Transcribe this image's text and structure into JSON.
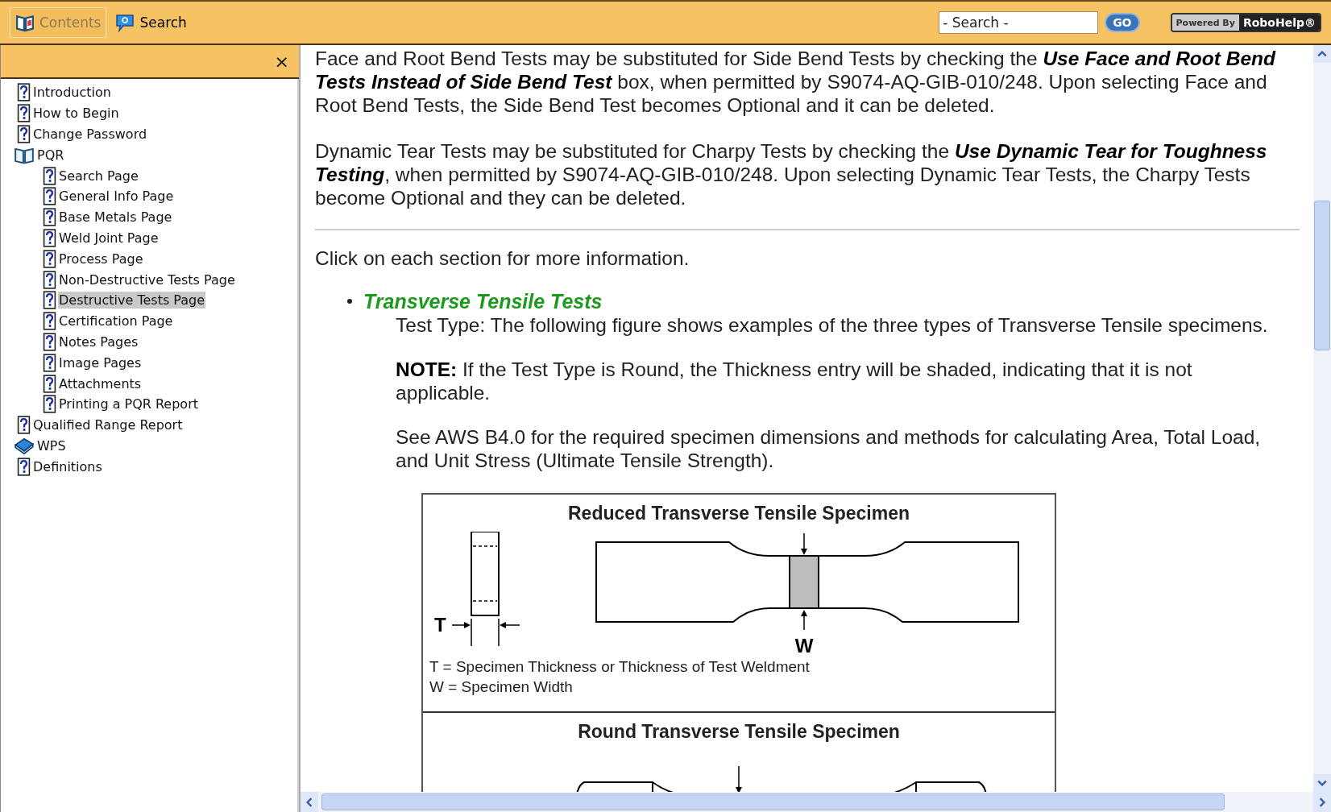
{
  "toolbar": {
    "tabs": [
      {
        "label": "Contents",
        "kind": "contents",
        "selected": true
      },
      {
        "label": "Search",
        "kind": "search",
        "selected": false
      }
    ],
    "search": {
      "placeholder": "- Search -"
    },
    "go_button": "GO",
    "badge": {
      "prefix": "Powered By",
      "brand": "RoboHelp®"
    }
  },
  "sidebar": {
    "close": "×",
    "items": [
      {
        "label": "Introduction",
        "kind": "topic",
        "selected": false
      },
      {
        "label": "How to Begin",
        "kind": "topic",
        "selected": false
      },
      {
        "label": "Change Password",
        "kind": "topic",
        "selected": false
      },
      {
        "label": "PQR",
        "kind": "book",
        "expanded": true,
        "selected": false,
        "children": [
          {
            "label": "Search Page",
            "kind": "topic",
            "selected": false
          },
          {
            "label": "General Info Page",
            "kind": "topic",
            "selected": false
          },
          {
            "label": "Base Metals Page",
            "kind": "topic",
            "selected": false
          },
          {
            "label": "Weld Joint Page",
            "kind": "topic",
            "selected": false
          },
          {
            "label": "Process Page",
            "kind": "topic",
            "selected": false
          },
          {
            "label": "Non-Destructive Tests Page",
            "kind": "topic",
            "selected": false
          },
          {
            "label": "Destructive Tests Page",
            "kind": "topic",
            "selected": true
          },
          {
            "label": "Certification Page",
            "kind": "topic",
            "selected": false
          },
          {
            "label": "Notes Pages",
            "kind": "topic",
            "selected": false
          },
          {
            "label": "Image Pages",
            "kind": "topic",
            "selected": false
          },
          {
            "label": "Attachments",
            "kind": "topic",
            "selected": false
          },
          {
            "label": "Printing a PQR Report",
            "kind": "topic",
            "selected": false
          }
        ]
      },
      {
        "label": "Qualified Range Report",
        "kind": "topic",
        "selected": false
      },
      {
        "label": "WPS",
        "kind": "book",
        "expanded": false,
        "selected": false
      },
      {
        "label": "Definitions",
        "kind": "topic",
        "selected": false
      }
    ]
  },
  "content": {
    "paragraphs": [
      "Face and Root Bend Tests may be substituted for Side Bend Tests by checking the **Use Face and Root Bend Tests Instead of Side Bend Test** box, when permitted by S9074-AQ-GIB-010/248. Upon selecting Face and Root Bend Tests, the Side Bend Test becomes Optional and it can be deleted.",
      "Dynamic Tear Tests may be substituted for Charpy Tests by checking the **Use Dynamic Tear for Toughness Testing**, when permitted by S9074-AQ-GIB-010/248.  Upon selecting Dynamic Tear Tests, the Charpy Tests become Optional and they can be deleted."
    ],
    "intro": "Click on each section for more information.",
    "section": {
      "link": "Transverse Tensile Tests",
      "paragraphs": [
        "Test Type: The following figure shows examples of the three types of Transverse Tensile specimens.",
        "**NOTE:** If the Test Type is Round, the Thickness entry will be shaded, indicating that it is not applicable.",
        "See AWS B4.0 for the required specimen dimensions and methods for calculating Area, Total Load, and Unit Stress (Ultimate Tensile Strength)."
      ],
      "figure": {
        "panels": [
          {
            "title": "Reduced Transverse Tensile Specimen",
            "kind": "reduced",
            "labels": [
              "T",
              "W"
            ],
            "legend": [
              "T = Specimen Thickness or Thickness of Test Weldment",
              "W = Specimen Width"
            ]
          },
          {
            "title": "Round Transverse Tensile Specimen",
            "kind": "round"
          }
        ]
      }
    }
  }
}
